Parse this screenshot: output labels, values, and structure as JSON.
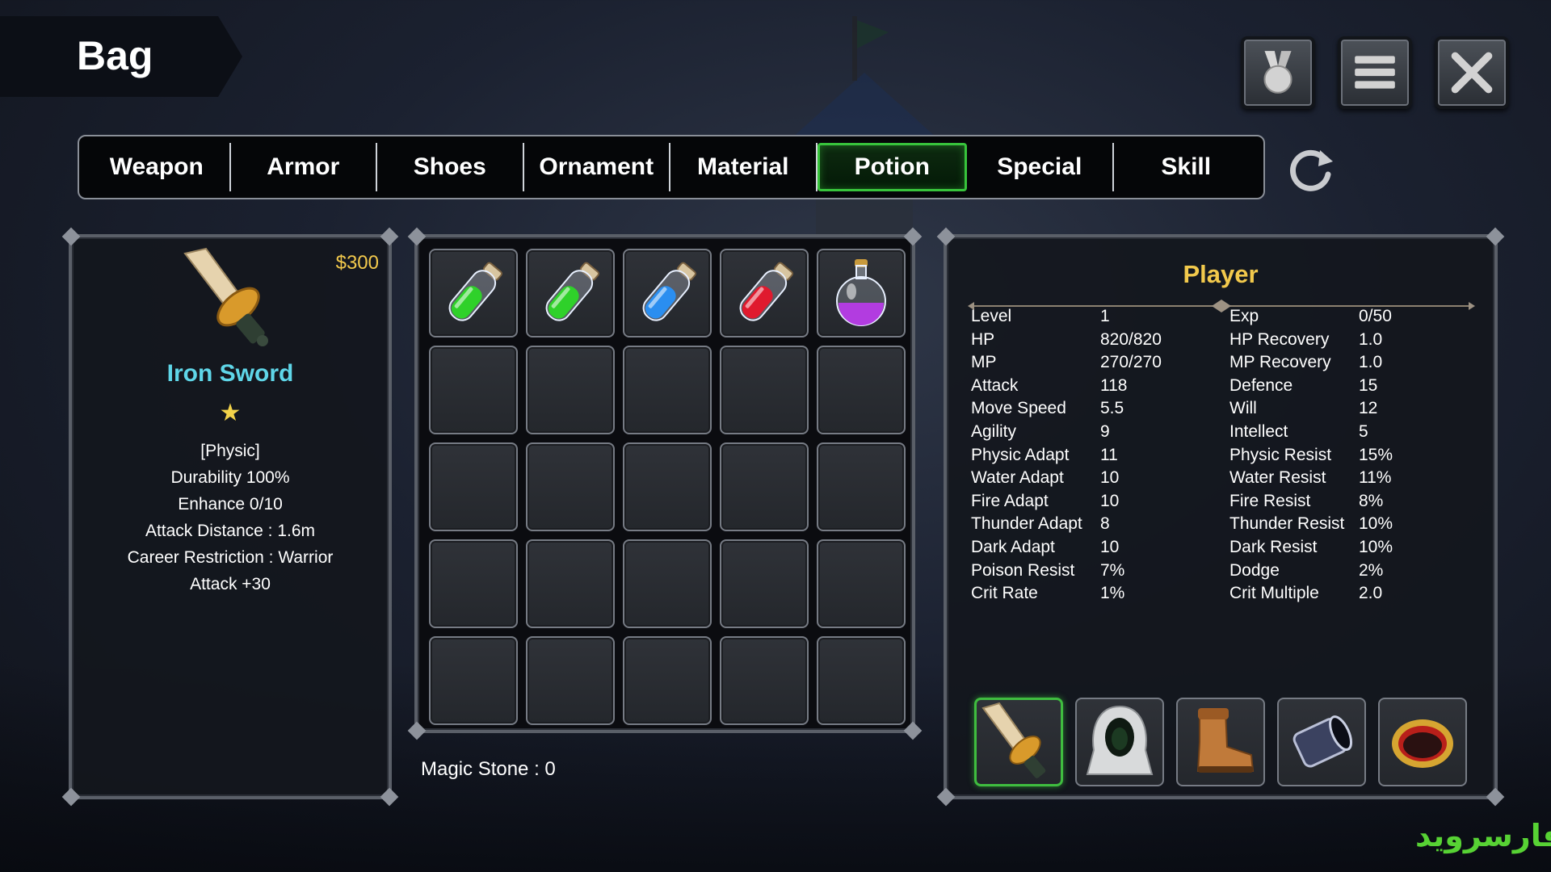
{
  "header": {
    "title": "Bag"
  },
  "top_buttons": [
    {
      "name": "medal-button",
      "icon": "medal-icon"
    },
    {
      "name": "menu-button",
      "icon": "hamburger-menu-icon"
    },
    {
      "name": "close-button",
      "icon": "close-icon"
    }
  ],
  "tabs": [
    {
      "label": "Weapon",
      "active": false
    },
    {
      "label": "Armor",
      "active": false
    },
    {
      "label": "Shoes",
      "active": false
    },
    {
      "label": "Ornament",
      "active": false
    },
    {
      "label": "Material",
      "active": false
    },
    {
      "label": "Potion",
      "active": true
    },
    {
      "label": "Special",
      "active": false
    },
    {
      "label": "Skill",
      "active": false
    }
  ],
  "refresh_icon": "refresh-icon",
  "item_detail": {
    "price": "$300",
    "name": "Iron Sword",
    "star": "★",
    "icon": "iron-sword-icon",
    "lines": [
      "[Physic]",
      "Durability 100%",
      "Enhance 0/10",
      "Attack Distance : 1.6m",
      "Career Restriction : Warrior",
      "Attack  +30"
    ]
  },
  "inventory": {
    "slots": [
      {
        "item": "green-potion-icon",
        "color": "#2fd12a"
      },
      {
        "item": "green-potion-icon",
        "color": "#2fd12a"
      },
      {
        "item": "blue-potion-icon",
        "color": "#2a8ef0"
      },
      {
        "item": "red-potion-icon",
        "color": "#e01a2e"
      },
      {
        "item": "purple-flask-icon",
        "color": "#b23ce0"
      },
      {},
      {},
      {},
      {},
      {},
      {},
      {},
      {},
      {},
      {},
      {},
      {},
      {},
      {},
      {},
      {},
      {},
      {},
      {},
      {}
    ],
    "magic_stone": "Magic Stone : 0"
  },
  "player": {
    "title": "Player",
    "left_stats": [
      {
        "label": "Level",
        "value": "1"
      },
      {
        "label": "HP",
        "value": "820/820"
      },
      {
        "label": "MP",
        "value": "270/270"
      },
      {
        "label": "Attack",
        "value": "118"
      },
      {
        "label": "Move Speed",
        "value": "5.5"
      },
      {
        "label": "Agility",
        "value": "9"
      },
      {
        "label": "Physic Adapt",
        "value": "11"
      },
      {
        "label": "Water Adapt",
        "value": "10"
      },
      {
        "label": "Fire Adapt",
        "value": "10"
      },
      {
        "label": "Thunder Adapt",
        "value": "8"
      },
      {
        "label": "Dark Adapt",
        "value": "10"
      },
      {
        "label": "Poison Resist",
        "value": "7%"
      },
      {
        "label": "Crit Rate",
        "value": "1%"
      }
    ],
    "right_stats": [
      {
        "label": "Exp",
        "value": "0/50"
      },
      {
        "label": "HP Recovery",
        "value": "1.0"
      },
      {
        "label": "MP Recovery",
        "value": "1.0"
      },
      {
        "label": "Defence",
        "value": "15"
      },
      {
        "label": "Will",
        "value": "12"
      },
      {
        "label": "Intellect",
        "value": "5"
      },
      {
        "label": "Physic Resist",
        "value": "15%"
      },
      {
        "label": "Water Resist",
        "value": "11%"
      },
      {
        "label": "Fire Resist",
        "value": "8%"
      },
      {
        "label": "Thunder Resist",
        "value": "10%"
      },
      {
        "label": "Dark Resist",
        "value": "10%"
      },
      {
        "label": "Dodge",
        "value": "2%"
      },
      {
        "label": "Crit Multiple",
        "value": "2.0"
      }
    ],
    "equipment": [
      {
        "icon": "iron-sword-icon",
        "selected": true
      },
      {
        "icon": "hood-armor-icon",
        "selected": false
      },
      {
        "icon": "leather-boot-icon",
        "selected": false
      },
      {
        "icon": "bracer-icon",
        "selected": false
      },
      {
        "icon": "gold-ring-icon",
        "selected": false
      }
    ]
  },
  "watermark": "فارسروید",
  "colors": {
    "accent_gold": "#f2c94c",
    "item_name": "#5fd6e8",
    "active_tab": "#38c43c",
    "watermark": "#57d234"
  }
}
